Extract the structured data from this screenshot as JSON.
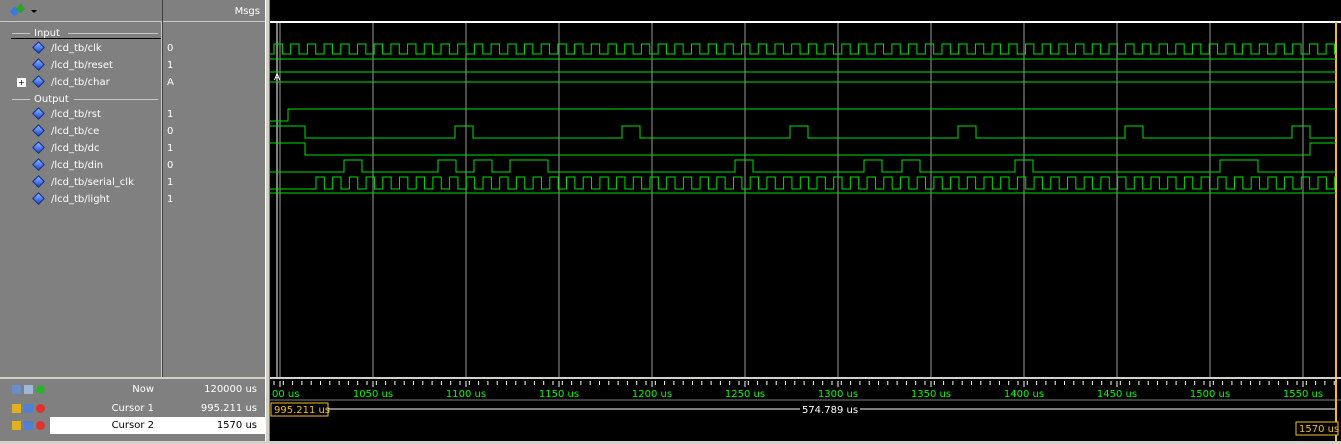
{
  "header": {
    "msgs_label": "Msgs",
    "toolbar_icon": "wave-toolbar-icon"
  },
  "groups": [
    {
      "label": "Input"
    },
    {
      "label": "Output"
    }
  ],
  "signals": [
    {
      "name": "/lcd_tb/clk",
      "value": "0"
    },
    {
      "name": "/lcd_tb/reset",
      "value": "1"
    },
    {
      "name": "/lcd_tb/char",
      "value": "A",
      "bus_label": "A"
    },
    {
      "name": "/lcd_tb/rst",
      "value": "1"
    },
    {
      "name": "/lcd_tb/ce",
      "value": "0"
    },
    {
      "name": "/lcd_tb/dc",
      "value": "1"
    },
    {
      "name": "/lcd_tb/din",
      "value": "0"
    },
    {
      "name": "/lcd_tb/serial_clk",
      "value": "1"
    },
    {
      "name": "/lcd_tb/light",
      "value": "1"
    }
  ],
  "status": {
    "now_label": "Now",
    "now_value": "120000 us",
    "cursor1_label": "Cursor 1",
    "cursor1_value": "995.211 us",
    "cursor2_label": "Cursor 2",
    "cursor2_value": "1570 us"
  },
  "timeline": {
    "ticks": [
      "00 us",
      "1050 us",
      "1100 us",
      "1150 us",
      "1200 us",
      "1250 us",
      "1300 us",
      "1350 us",
      "1400 us",
      "1450 us",
      "1500 us",
      "1550 us"
    ],
    "cursor1_flag": "995.211 us",
    "cursor2_flag": "1570 us",
    "delta_label": "574.789 us"
  },
  "colors": {
    "wave": "#00e000",
    "grid": "#9a9a9a",
    "cursor": "#f0c020",
    "panel": "#808080",
    "background": "#000000"
  }
}
